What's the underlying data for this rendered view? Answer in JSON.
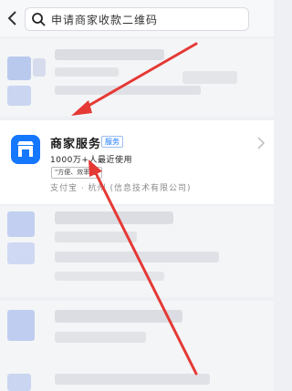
{
  "search": {
    "query": "申请商家收款二维码"
  },
  "result": {
    "title": "商家服务",
    "tag": "服务",
    "users": "1000万+人最近使用",
    "slogan": "\"方便、效率高\"",
    "provider": "支付宝 · 杭州 (信息技术有限公司)"
  },
  "colors": {
    "accent": "#1677ff",
    "arrow": "#e53935"
  },
  "icons": {
    "back": "chevron-left-icon",
    "search": "search-icon",
    "app": "storefront-icon",
    "more": "chevron-right-icon"
  }
}
